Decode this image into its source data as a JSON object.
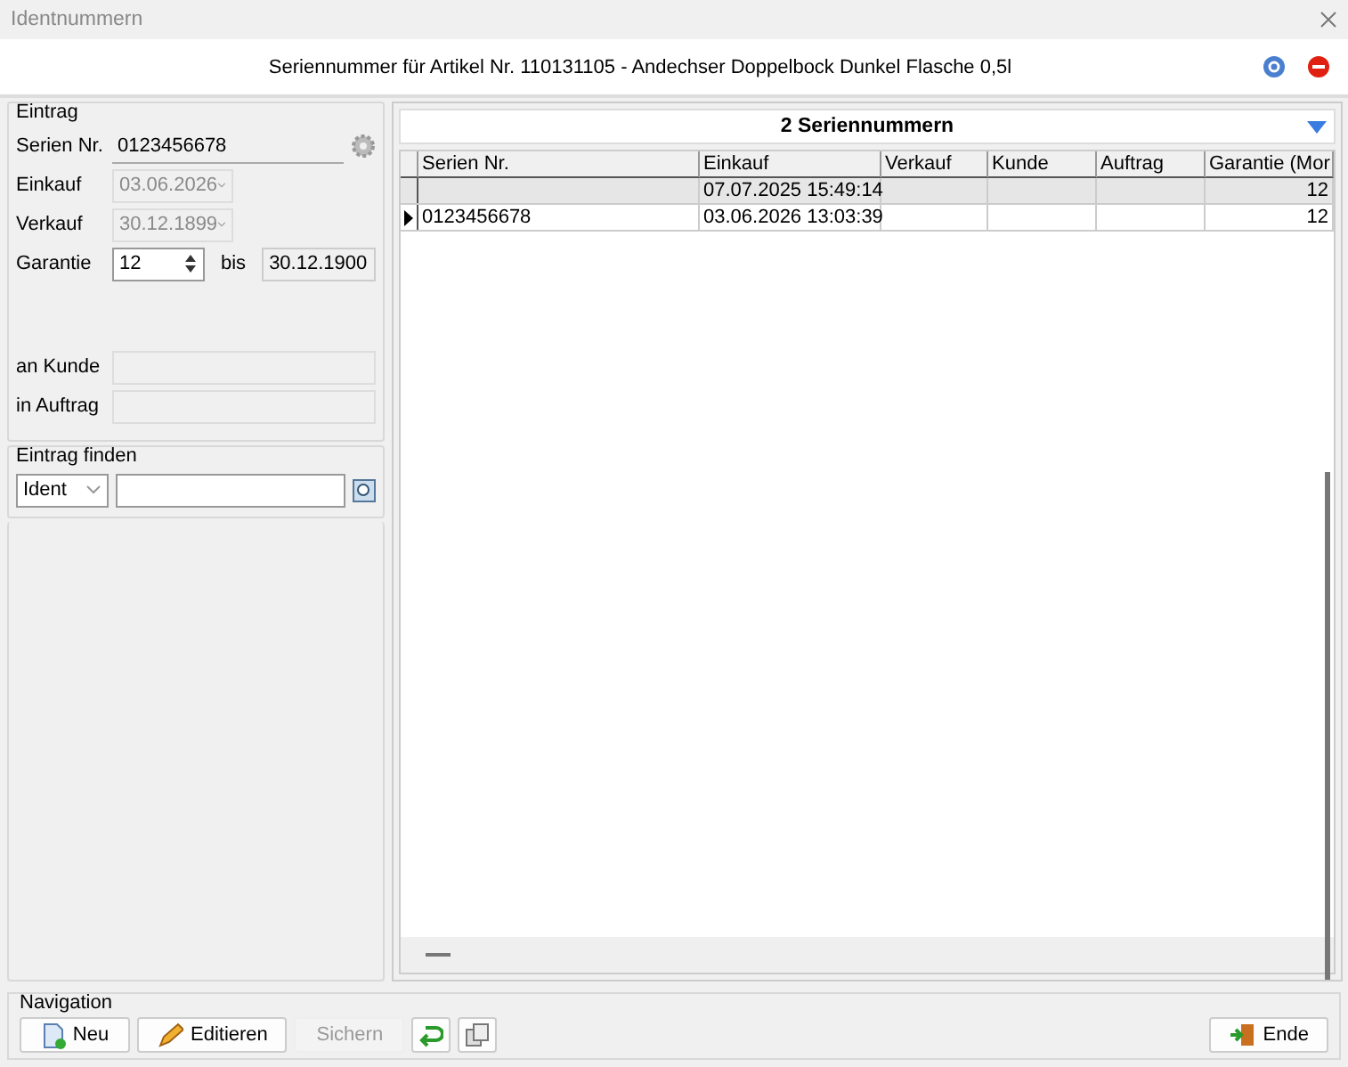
{
  "window": {
    "title": "Identnummern"
  },
  "header": {
    "text": "Seriennummer für Artikel Nr. 110131105 - Andechser Doppelbock Dunkel Flasche 0,5l"
  },
  "entry": {
    "title": "Eintrag",
    "fields": [
      {
        "kind": "text",
        "label": "Serien Nr.",
        "value": "0123456678",
        "disabled": true
      },
      {
        "kind": "date",
        "label": "Einkauf",
        "value": "03.06.2026",
        "disabled": true
      },
      {
        "kind": "date",
        "label": "Verkauf",
        "value": "30.12.1899",
        "disabled": true
      }
    ],
    "warranty": {
      "label": "Garantie",
      "value": "12",
      "between": "bis",
      "until": "30.12.1900"
    },
    "links": [
      {
        "label": "an Kunde"
      },
      {
        "label": "in Auftrag"
      }
    ]
  },
  "find": {
    "title": "Eintrag finden",
    "mode": "Ident"
  },
  "grid": {
    "title": "2 Seriennummern",
    "columns": [
      "Serien Nr.",
      "Einkauf",
      "Verkauf",
      "Kunde",
      "Auftrag",
      "Garantie (Mor"
    ],
    "rows": [
      {
        "cells": [
          "",
          "07.07.2025 15:49:14",
          "",
          "",
          "",
          "12"
        ],
        "selected": true,
        "current": false
      },
      {
        "cells": [
          "0123456678",
          "03.06.2026 13:03:39",
          "",
          "",
          "",
          "12"
        ],
        "selected": false,
        "current": true
      }
    ]
  },
  "navigation": {
    "title": "Navigation",
    "buttons": [
      {
        "kind": "new",
        "label": "Neu",
        "disabled": false
      },
      {
        "kind": "edit",
        "label": "Editieren",
        "disabled": false
      },
      {
        "kind": "save",
        "label": "Sichern",
        "disabled": true
      },
      {
        "kind": "undo",
        "disabled": false
      },
      {
        "kind": "copy",
        "disabled": false
      }
    ],
    "exit": {
      "label": "Ende"
    }
  }
}
